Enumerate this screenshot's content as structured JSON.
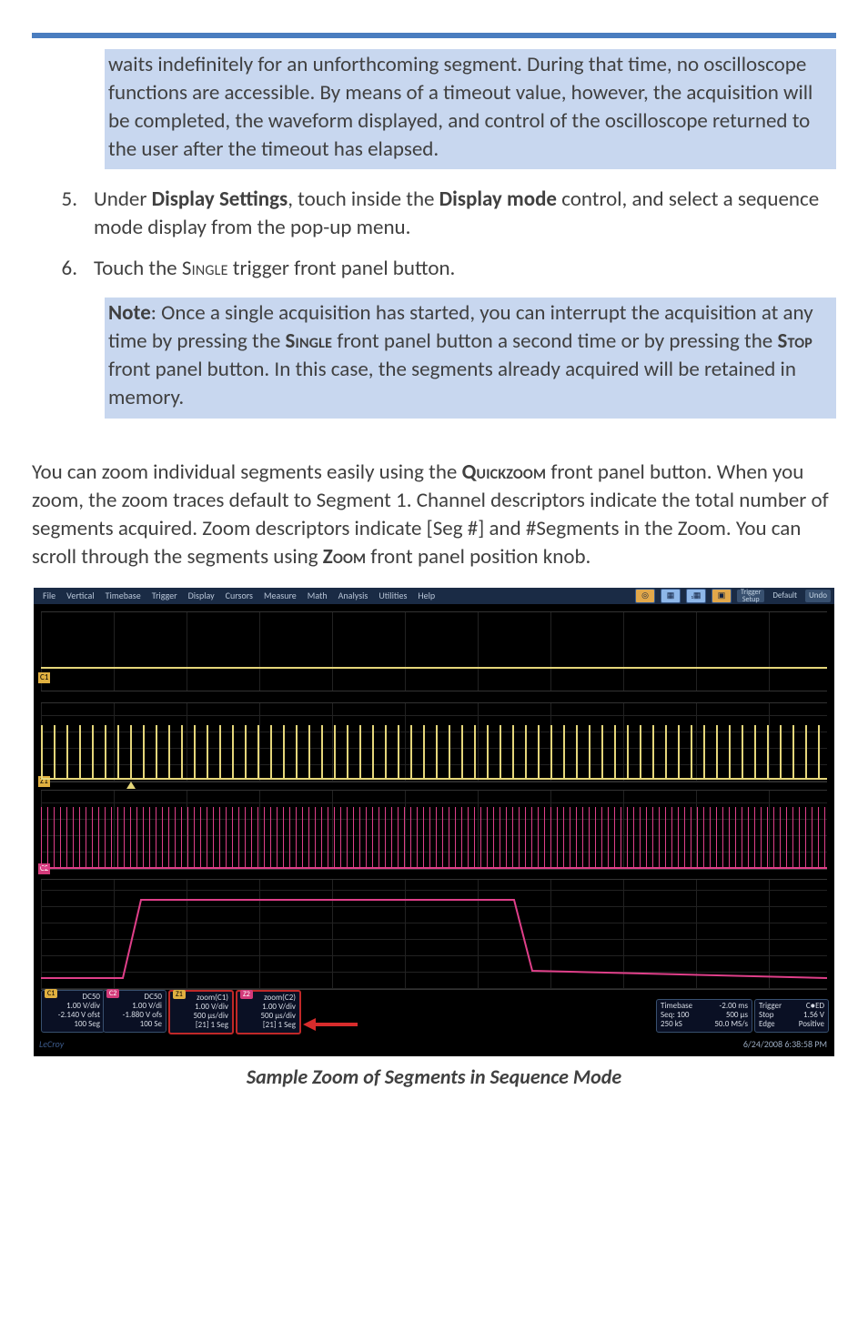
{
  "note1": "waits indefinitely for an unforthcoming segment. During that time, no oscilloscope functions are accessible. By means of a timeout value, however, the acquisition will be completed, the waveform displayed, and control of the oscilloscope returned to the user after the timeout has elapsed.",
  "steps": {
    "s5": {
      "num": "5.",
      "pre": "Under ",
      "b1": "Display Settings",
      "mid1": ", touch inside the ",
      "b2": "Display mode",
      "post": " control, and select a sequence mode display from the pop-up menu."
    },
    "s6": {
      "num": "6.",
      "pre": "Touch the ",
      "sc": "Single",
      "post": " trigger front panel button."
    }
  },
  "note2": {
    "lead": "Note",
    "t1": ": Once a single acquisition has started, you can interrupt the acquisition at any time by pressing the ",
    "b1": "Single",
    "t2": " front panel button a second time or by pressing the ",
    "b2": "Stop",
    "t3": " front panel button. In this case, the segments already acquired will be retained in memory."
  },
  "para": {
    "t1": "You can zoom individual segments easily using the ",
    "b1": "Quickzoom",
    "t2": " front panel button. When you zoom, the zoom traces default to Segment 1. Channel descriptors indicate the total number of segments acquired. Zoom descriptors indicate [Seg #] and #Segments in the Zoom. You can scroll through the segments using ",
    "b2": "Zoom",
    "t3": " front panel position knob."
  },
  "figcaption": "Sample Zoom of Segments in Sequence Mode",
  "menu": {
    "items": [
      "File",
      "Vertical",
      "Timebase",
      "Trigger",
      "Display",
      "Cursors",
      "Measure",
      "Math",
      "Analysis",
      "Utilities",
      "Help"
    ],
    "trigger": "Trigger",
    "setup": "Setup",
    "default": "Default",
    "undo": "Undo"
  },
  "labels": {
    "c1": "C1",
    "z1": "Z1",
    "c2": "C2",
    "z2": "Z2"
  },
  "chips": {
    "c1": {
      "hdr": "C1",
      "l1": "DC50",
      "l2": "1.00 V/div",
      "l3": "-2.140 V ofst",
      "l4": "100 Seg"
    },
    "c2": {
      "hdr": "C2",
      "l1": "DC50",
      "l2": "1.00 V/di",
      "l3": "-1.880 V ofs",
      "l4": "100 Se"
    },
    "z1": {
      "hdr": "Z1",
      "l1": "zoom(C1)",
      "l2": "1.00 V/div",
      "l3": "500 µs/div",
      "l4": "[21] 1 Seg"
    },
    "z2": {
      "hdr": "Z2",
      "l1": "zoom(C2)",
      "l2": "1.00 V/div",
      "l3": "500 µs/div",
      "l4": "[21] 1 Seg"
    },
    "tb": {
      "hdr": "Timebase",
      "r1a": "",
      "r1b": "-2.00 ms",
      "r2a": "Seq: 100",
      "r2b": "500 µs",
      "r3a": "250 kS",
      "r3b": "50.0 MS/s"
    },
    "tr": {
      "hdr": "Trigger",
      "r1a": "",
      "r1b": "C●ED",
      "r2a": "Stop",
      "r2b": "1.56 V",
      "r3a": "Edge",
      "r3b": "Positive"
    }
  },
  "footer": {
    "brand": "LeCroy",
    "ts": "6/24/2008 6:38:58 PM"
  }
}
